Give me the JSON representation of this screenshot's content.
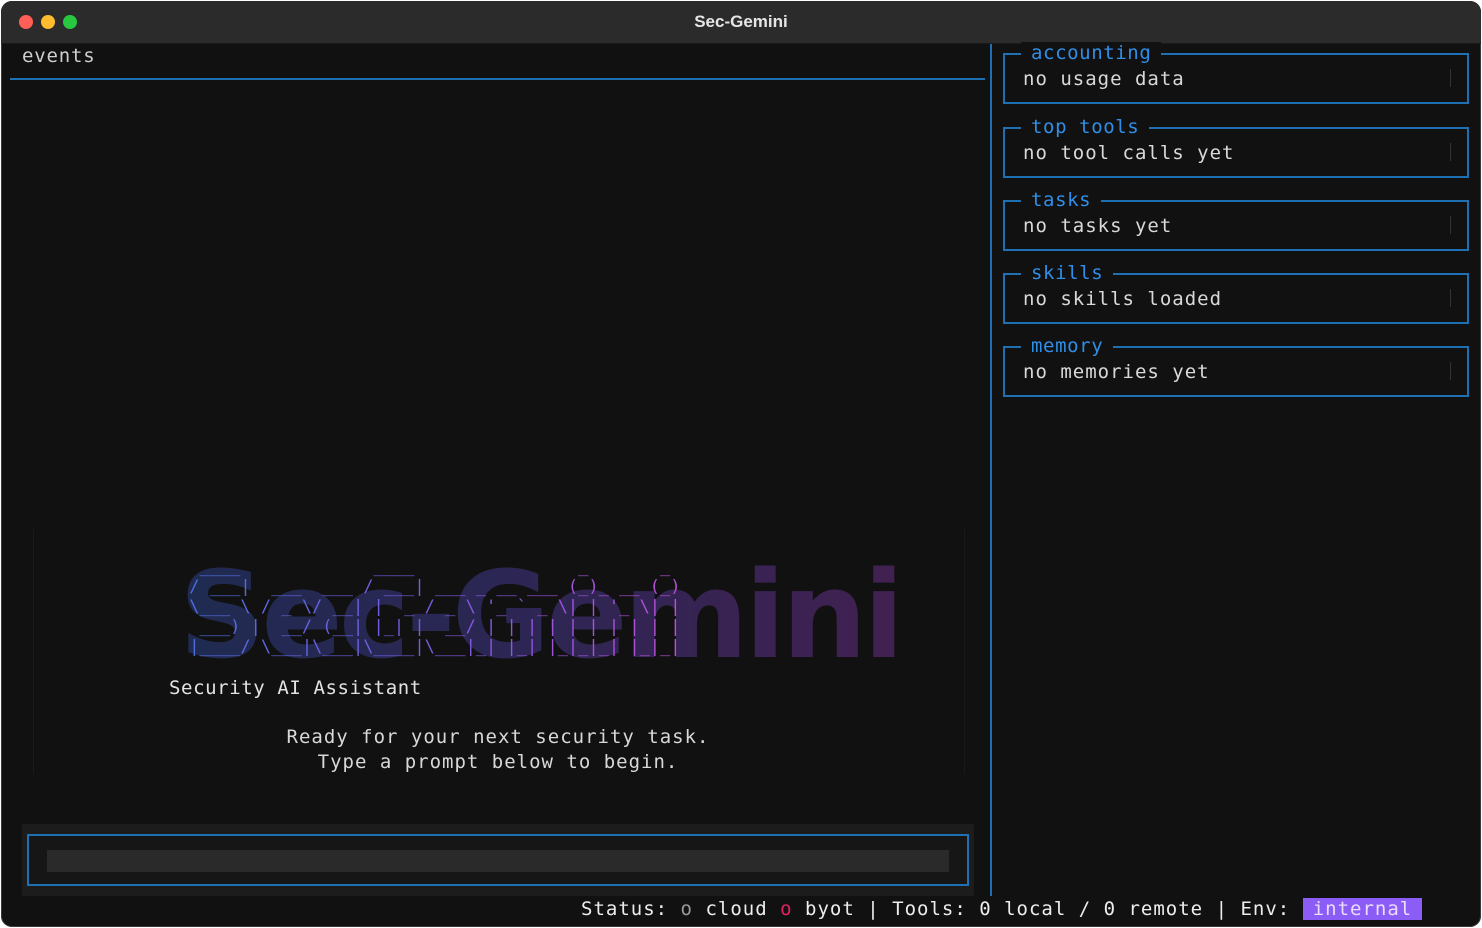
{
  "window": {
    "title": "Sec-Gemini"
  },
  "events": {
    "label": "events"
  },
  "banner": {
    "ascii_big": "Sec-Gemini",
    "ascii_art": "  ____             ____                _       _ \n / ___|  ___  ___ / ___| ___ _ __ ___ (_)_ __ (_)\n \\___ \\ / _ \\/ __| |  _ / _ \\ '_ ` _ \\| | '_ \\| |\n  ___) |  __/ (__| |_| |  __/ | | | | | | | | | |\n |____/ \\___|\\___|\\____|\\___|_| |_| |_|_|_| |_|_|",
    "subtitle": "Security AI Assistant",
    "ready_line1": "Ready for your next security task.",
    "ready_line2": "Type a prompt below to begin."
  },
  "prompt": {
    "value": "",
    "placeholder": ""
  },
  "panels": [
    {
      "title": "accounting",
      "body": "no usage data"
    },
    {
      "title": "top tools",
      "body": "no tool calls yet"
    },
    {
      "title": "tasks",
      "body": "no tasks yet"
    },
    {
      "title": "skills",
      "body": "no skills loaded"
    },
    {
      "title": "memory",
      "body": "no memories yet"
    }
  ],
  "status": {
    "status_label": "Status:",
    "dot1": "o",
    "cloud_label": "cloud",
    "dot2": "o",
    "byot_label": "byot",
    "sep1": "|",
    "tools_label": "Tools:",
    "tools_value": "0 local / 0 remote",
    "sep2": "|",
    "env_label": "Env:",
    "env_value": "internal"
  },
  "colors": {
    "accent_border": "#1f6fb3",
    "panel_title": "#2f8fe8",
    "env_badge": "#8b5cf6",
    "byot_dot": "#e0245e"
  }
}
